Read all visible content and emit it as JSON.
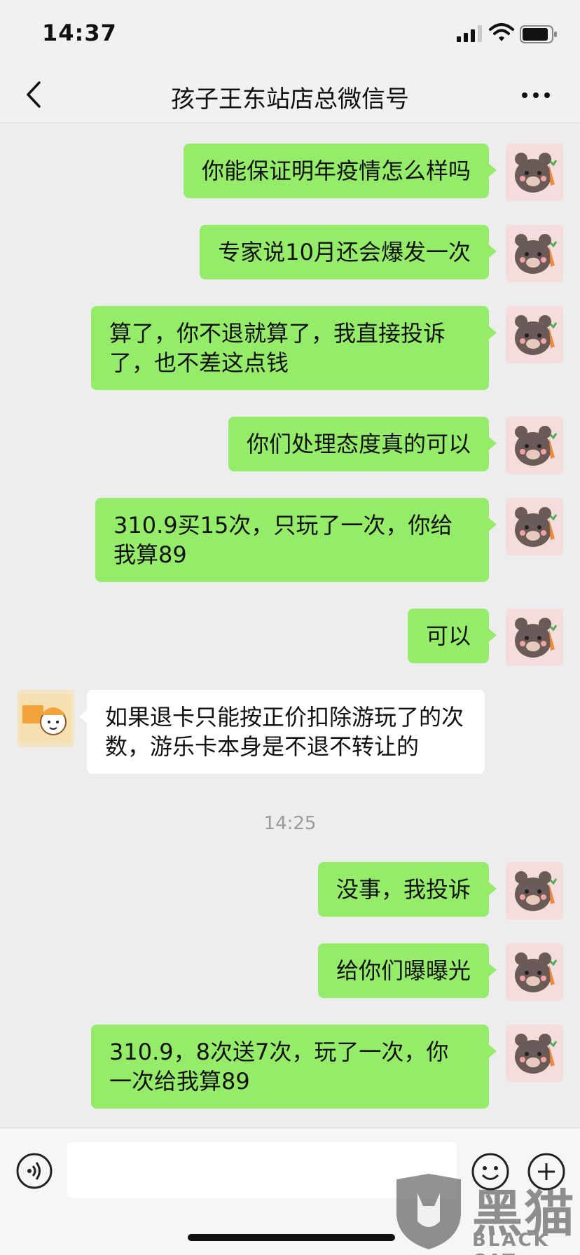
{
  "status_bar": {
    "time": "14:37"
  },
  "nav": {
    "title": "孩子王东站店总微信号"
  },
  "messages": [
    {
      "side": "me",
      "text": "你能保证明年疫情怎么样吗"
    },
    {
      "side": "me",
      "text": "专家说10月还会爆发一次"
    },
    {
      "side": "me",
      "text": "算了，你不退就算了，我直接投诉了，也不差这点钱"
    },
    {
      "side": "me",
      "text": "你们处理态度真的可以"
    },
    {
      "side": "me",
      "text": "310.9买15次，只玩了一次，你给我算89"
    },
    {
      "side": "me",
      "text": "可以"
    },
    {
      "side": "other",
      "text": "如果退卡只能按正价扣除游玩了的次数，游乐卡本身是不退不转让的"
    },
    {
      "timestamp": "14:25"
    },
    {
      "side": "me",
      "text": "没事，我投诉"
    },
    {
      "side": "me",
      "text": "给你们曝曝光"
    },
    {
      "side": "me",
      "text": "310.9，8次送7次，玩了一次，你一次给我算89"
    }
  ],
  "input": {
    "placeholder": ""
  },
  "watermark": {
    "brand": "黑猫",
    "sub": "BLACK CAT"
  },
  "colors": {
    "my_bubble": "#95ec69",
    "other_bubble": "#ffffff",
    "background": "#ededed"
  },
  "icons": [
    "back-icon",
    "more-icon",
    "voice-icon",
    "emoji-icon",
    "plus-icon"
  ]
}
